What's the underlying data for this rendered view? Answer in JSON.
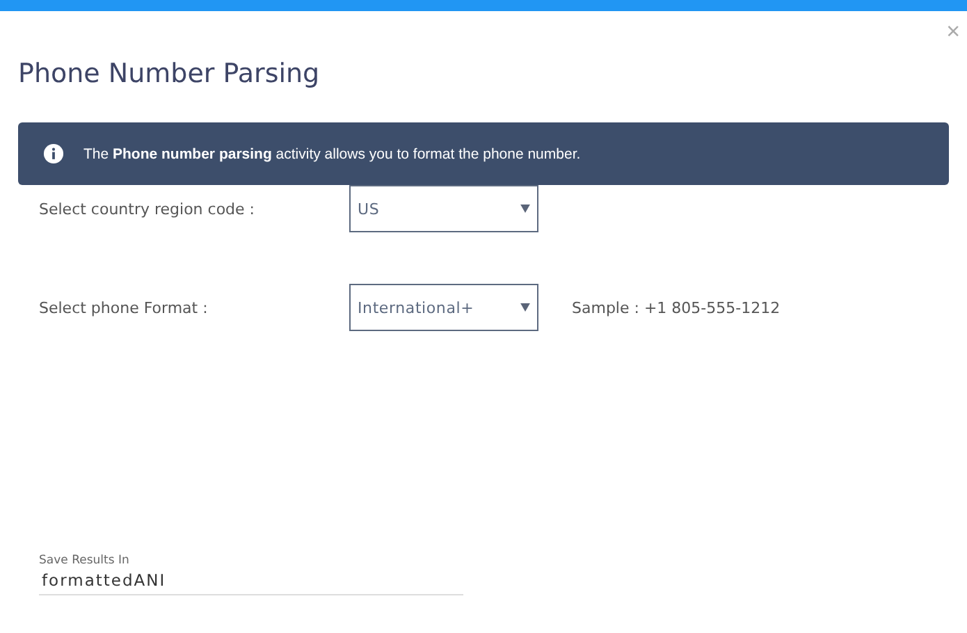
{
  "dialog": {
    "title": "Phone Number Parsing",
    "close": "×"
  },
  "info_banner": {
    "text": "The **Phone number parsing** activity allows you to format the phone number."
  },
  "fields": [
    {
      "label": "Select country region code :",
      "value": "US"
    },
    {
      "label": "Select phone Format :",
      "value": "International+",
      "sample": "Sample : +1 805-555-1212"
    }
  ],
  "save_results": {
    "label": "Save Results In",
    "value": "formattedANI"
  }
}
